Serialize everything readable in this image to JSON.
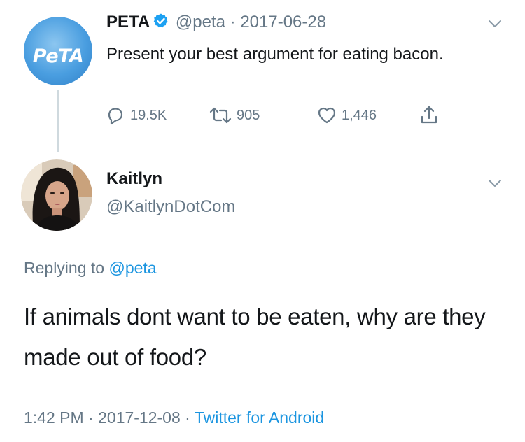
{
  "parent_tweet": {
    "avatar_text": "PeTA",
    "display_name": "PETA",
    "handle": "@peta",
    "separator": "·",
    "date": "2017-06-28",
    "text": "Present your best argument for eating bacon.",
    "stats": {
      "replies": "19.5K",
      "retweets": "905",
      "likes": "1,446"
    }
  },
  "reply_tweet": {
    "display_name": "Kaitlyn",
    "handle": "@KaitlynDotCom",
    "replying_prefix": "Replying to",
    "replying_to": "@peta",
    "text": "If animals dont want to be eaten, why are they made out of food?",
    "time": "1:42 PM",
    "separator": "·",
    "date": "2017-12-08",
    "source": "Twitter for Android"
  },
  "icons": {
    "verified": "verified-badge-icon",
    "chevron": "chevron-down-icon",
    "reply": "reply-icon",
    "retweet": "retweet-icon",
    "like": "heart-icon",
    "share": "share-icon"
  },
  "colors": {
    "text_primary": "#14171a",
    "text_secondary": "#657786",
    "link": "#1b95e0",
    "verified": "#1da1f2",
    "thread_line": "#cfd9de"
  }
}
